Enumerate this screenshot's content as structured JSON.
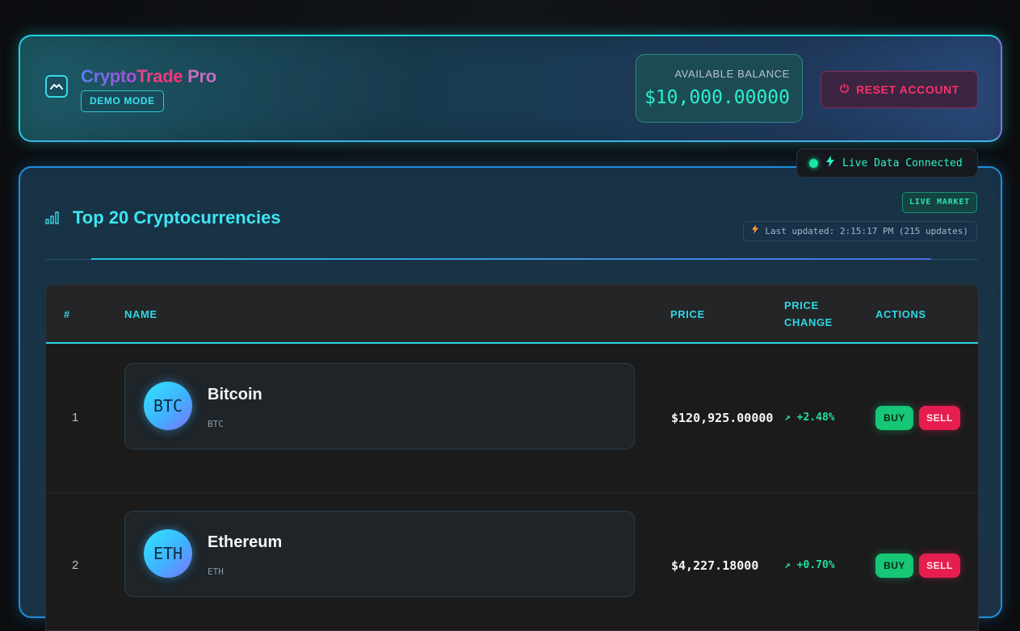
{
  "header": {
    "brand_part1": "Crypto",
    "brand_part2": "Trade",
    "brand_part3": " Pro",
    "mode_badge": "DEMO MODE",
    "balance_label": "AVAILABLE BALANCE",
    "balance_value": "$10,000.00000",
    "reset_label": "RESET ACCOUNT"
  },
  "connection": {
    "status": "Live Data Connected"
  },
  "market": {
    "title": "Top 20 Cryptocurrencies",
    "live_badge": "LIVE MARKET",
    "last_updated": "Last updated: 2:15:17 PM (215 updates)"
  },
  "table": {
    "columns": {
      "rank": "#",
      "name": "NAME",
      "price": "PRICE",
      "change_line1": "PRICE",
      "change_line2": "CHANGE",
      "actions": "ACTIONS"
    },
    "rows": [
      {
        "rank": "1",
        "avatar": "BTC",
        "name": "Bitcoin",
        "symbol": "BTC",
        "price": "$120,925.00000",
        "change": "↗ +2.48%",
        "buy": "BUY",
        "sell": "SELL"
      },
      {
        "rank": "2",
        "avatar": "ETH",
        "name": "Ethereum",
        "symbol": "ETH",
        "price": "$4,227.18000",
        "change": "↗ +0.70%",
        "buy": "BUY",
        "sell": "SELL"
      }
    ]
  },
  "colors": {
    "accent_cyan": "#2fd6e6",
    "positive_green": "#1fe29a",
    "buy_green": "#16c776",
    "sell_red": "#e51e4f",
    "reset_red": "#ff2f6d"
  },
  "icons": {
    "logo": "trend-wave-icon",
    "reset": "power-icon",
    "live": "lightning-icon",
    "market": "signal-bars-icon",
    "updated": "lightning-icon"
  }
}
